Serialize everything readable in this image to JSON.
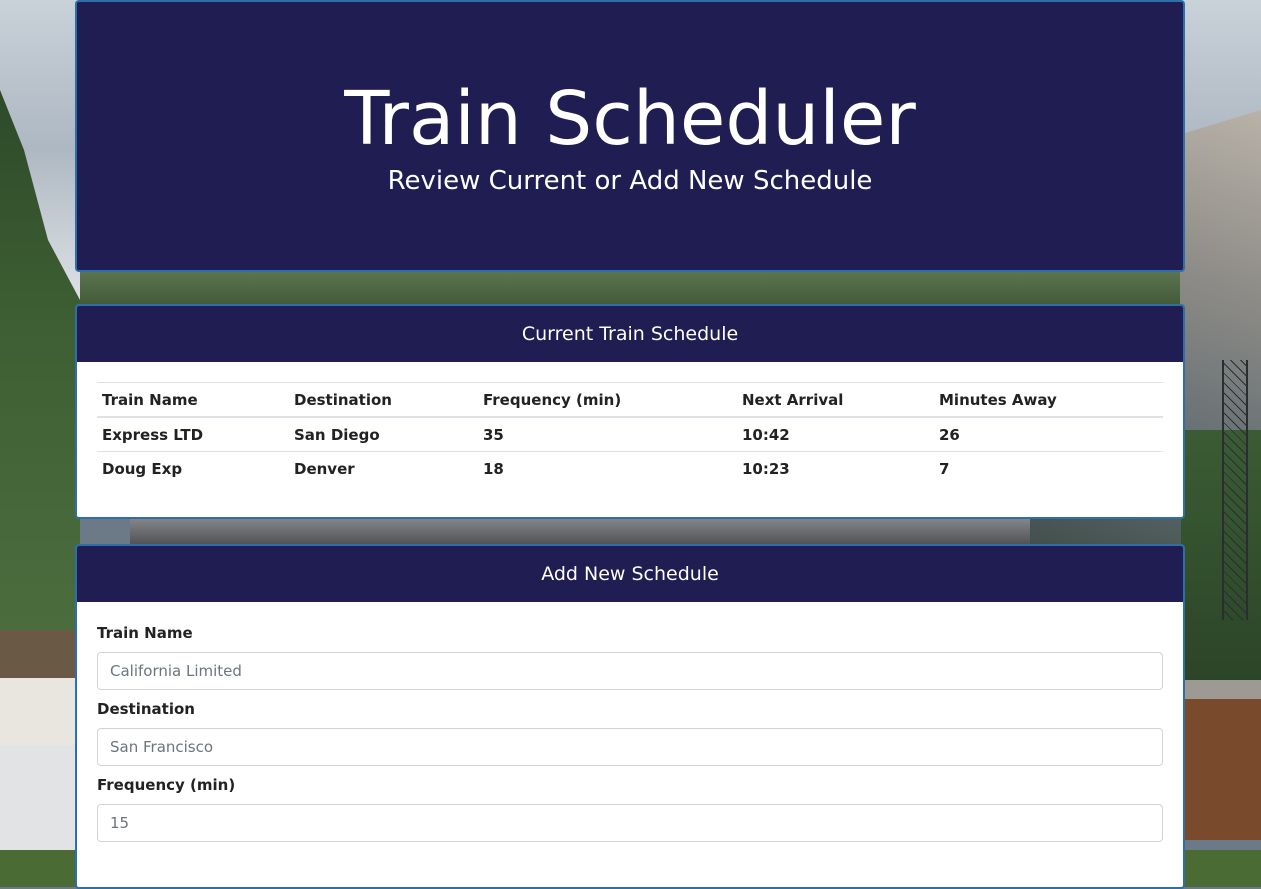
{
  "header": {
    "title": "Train Scheduler",
    "subtitle": "Review Current or Add New Schedule"
  },
  "schedule": {
    "heading": "Current Train Schedule",
    "columns": [
      "Train Name",
      "Destination",
      "Frequency (min)",
      "Next Arrival",
      "Minutes Away"
    ],
    "rows": [
      [
        "Express LTD",
        "San Diego",
        "35",
        "10:42",
        "26"
      ],
      [
        "Doug Exp",
        "Denver",
        "18",
        "10:23",
        "7"
      ]
    ]
  },
  "form": {
    "heading": "Add New Schedule",
    "fields": [
      {
        "label": "Train Name",
        "placeholder": "California Limited"
      },
      {
        "label": "Destination",
        "placeholder": "San Francisco"
      },
      {
        "label": "Frequency (min)",
        "placeholder": "15"
      }
    ]
  },
  "colors": {
    "header_bg": "#1f1d51",
    "card_border": "#2f6ea8"
  }
}
